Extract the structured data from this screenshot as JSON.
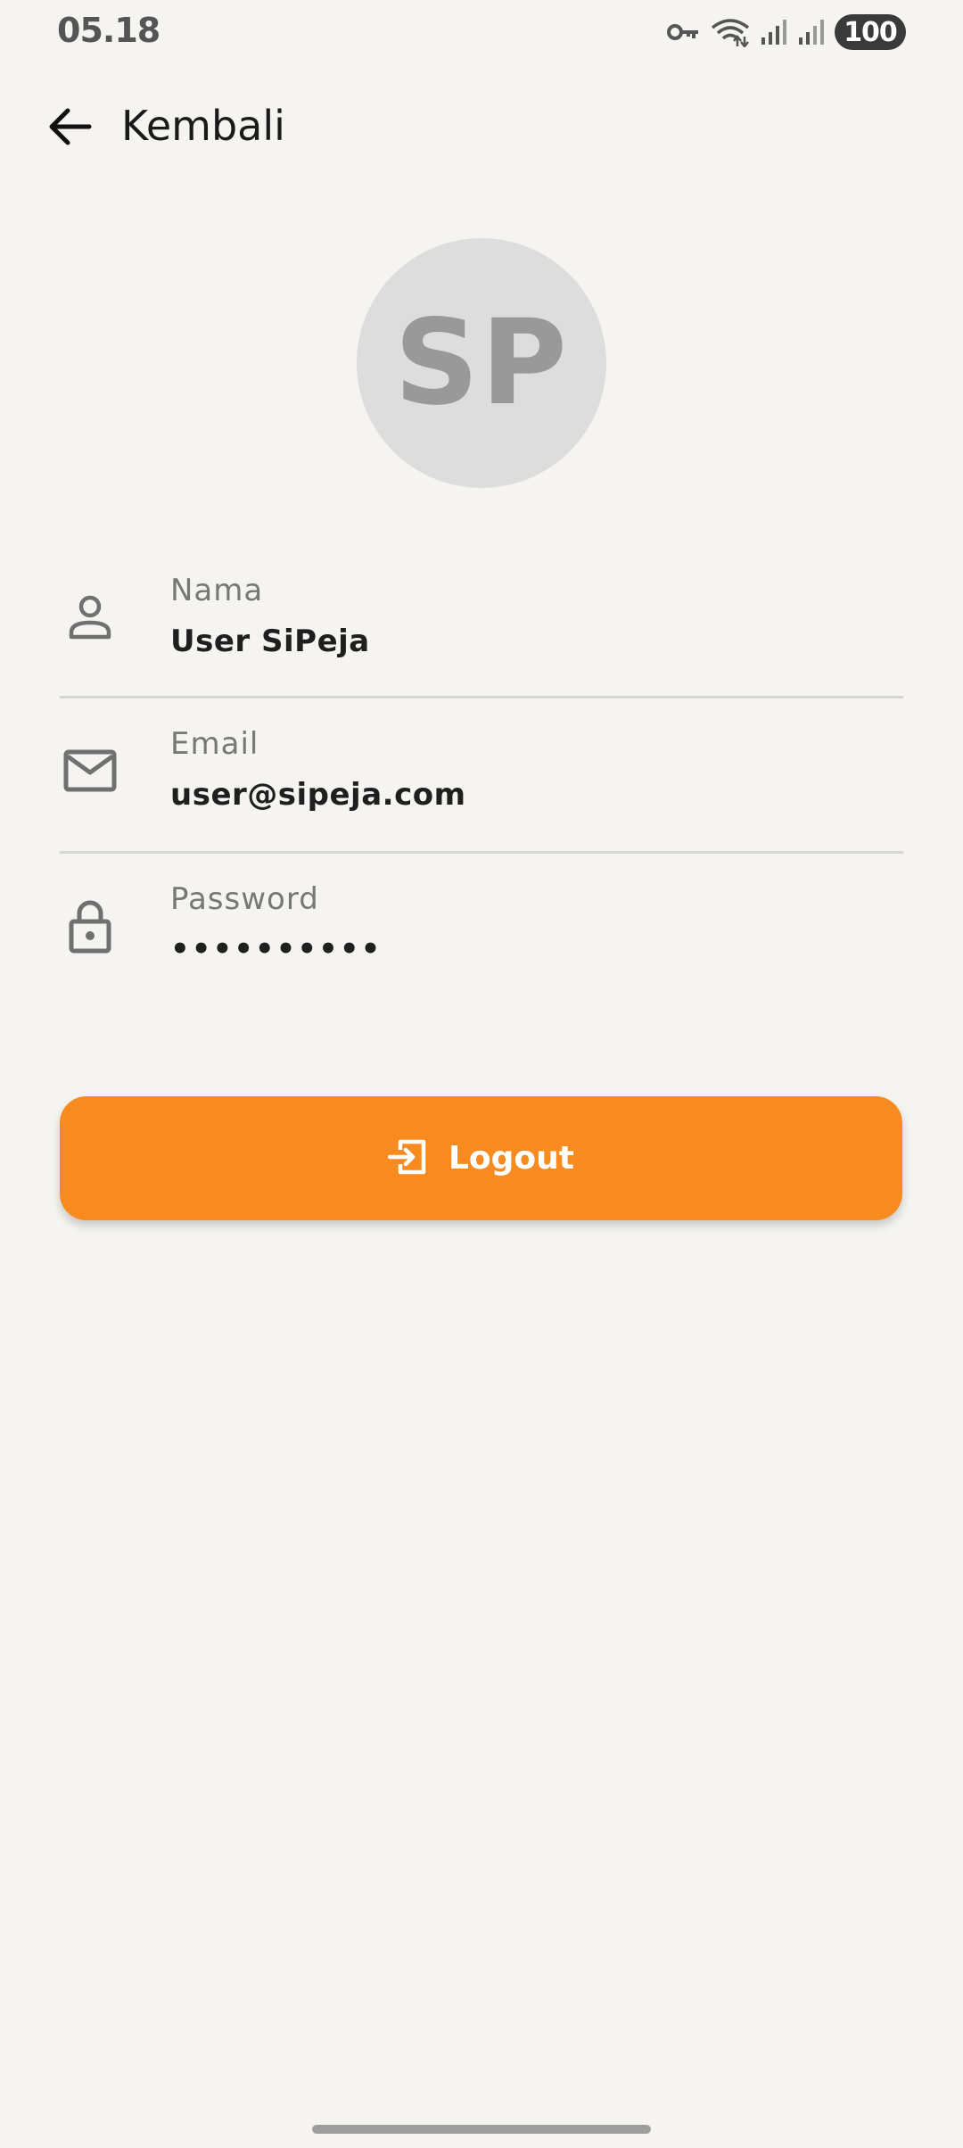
{
  "status_bar": {
    "time": "05.18",
    "battery": "100",
    "icons": [
      "vpn-key-icon",
      "wifi-icon",
      "signal-icon",
      "signal-icon"
    ]
  },
  "app_bar": {
    "back_icon": "arrow-left-icon",
    "title": "Kembali"
  },
  "profile": {
    "avatar_initials": "SP",
    "fields": [
      {
        "icon": "person-icon",
        "label": "Nama",
        "value": "User SiPeja"
      },
      {
        "icon": "mail-icon",
        "label": "Email",
        "value": "user@sipeja.com"
      },
      {
        "icon": "lock-icon",
        "label": "Password",
        "value": "••••••••••"
      }
    ]
  },
  "logout": {
    "icon": "logout-icon",
    "label": "Logout"
  },
  "colors": {
    "background": "#f5f4f1",
    "accent": "#f78b20",
    "avatar_bg": "#dddddd"
  }
}
